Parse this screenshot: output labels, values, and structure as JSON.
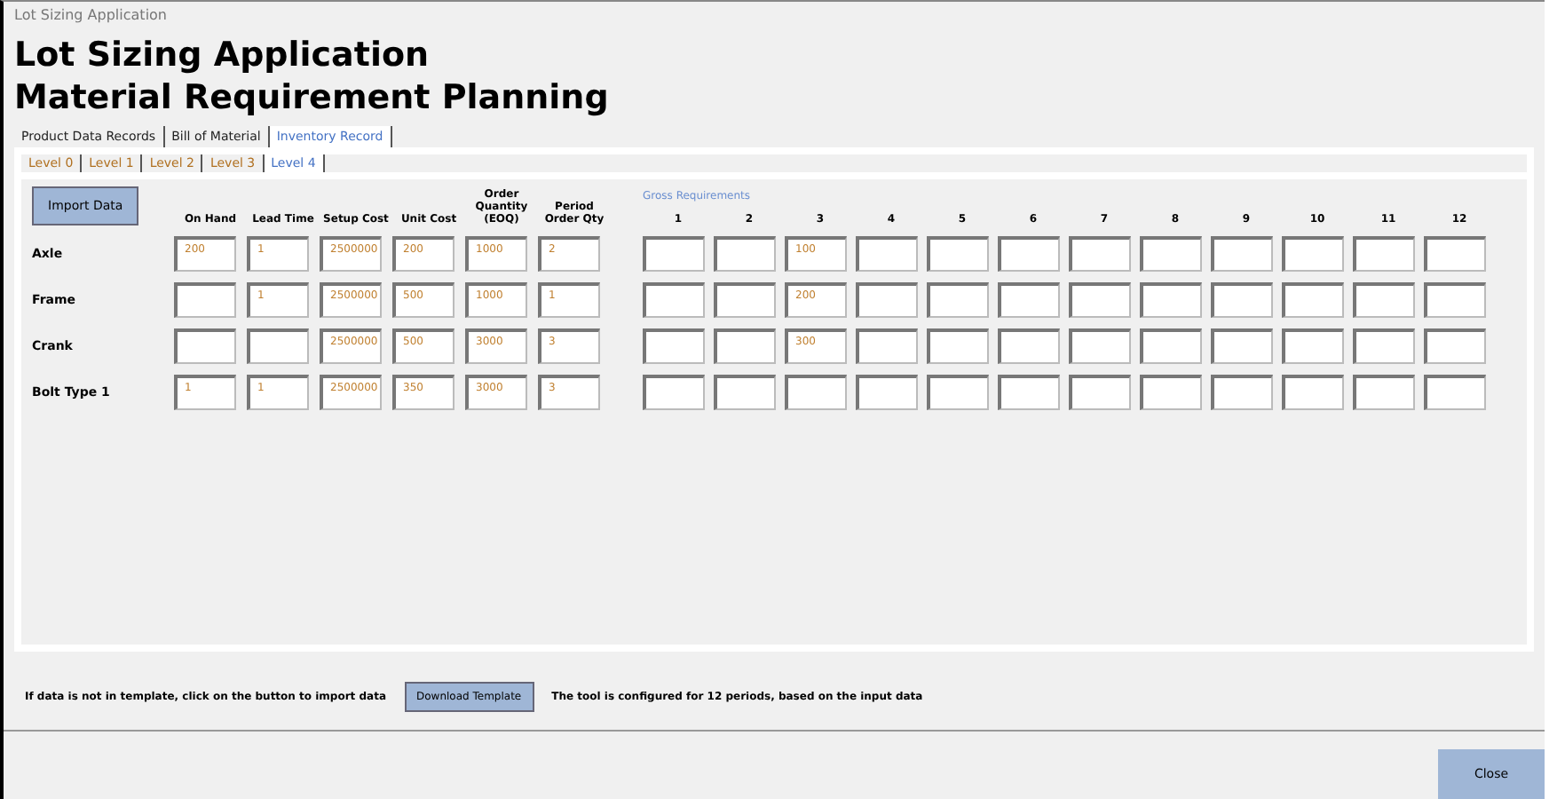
{
  "window": {
    "title": "Lot Sizing Application"
  },
  "headings": [
    "Lot Sizing Application",
    "Material Requirement Planning"
  ],
  "tabs": [
    {
      "label": "Product Data Records",
      "selected": false
    },
    {
      "label": "Bill of Material",
      "selected": false
    },
    {
      "label": "Inventory Record",
      "selected": true
    }
  ],
  "level_tabs": [
    {
      "label": "Level 0",
      "selected": false
    },
    {
      "label": "Level 1",
      "selected": false
    },
    {
      "label": "Level 2",
      "selected": false
    },
    {
      "label": "Level 3",
      "selected": false
    },
    {
      "label": "Level 4",
      "selected": true
    }
  ],
  "import_button": "Import Data",
  "columns": [
    "On Hand",
    "Lead Time",
    "Setup Cost",
    "Unit Cost",
    "Order Quantity (EOQ)",
    "Period Order Qty"
  ],
  "periods_label": "Gross Requirements",
  "periods": [
    "1",
    "2",
    "3",
    "4",
    "5",
    "6",
    "7",
    "8",
    "9",
    "10",
    "11",
    "12"
  ],
  "rows": [
    {
      "name": "Axle",
      "on_hand": "200",
      "lead_time": "1",
      "setup_cost": "2500000",
      "unit_cost": "200",
      "order_quantity": "1000",
      "period_order_qty": "2",
      "gross_requirements": {
        "period_3": "100"
      }
    },
    {
      "name": "Frame",
      "lead_time": "1",
      "setup_cost": "2500000",
      "unit_cost": "500",
      "order_quantity": "1000",
      "period_order_qty": "1",
      "gross_requirements": {
        "period_3": "200"
      }
    },
    {
      "name": "Crank",
      "setup_cost": "2500000",
      "unit_cost": "500",
      "order_quantity": "3000",
      "period_order_qty": "3",
      "gross_requirements": {
        "period_3": "300"
      }
    },
    {
      "name": "Bolt Type 1",
      "on_hand": "1",
      "lead_time": "1",
      "setup_cost": "2500000",
      "unit_cost": "350",
      "order_quantity": "3000",
      "period_order_qty": "3"
    }
  ],
  "footer": {
    "hint": "If data is not in template, click on the button to import data",
    "template_button": "Download Template",
    "note": "The tool is configured for 12 periods, based on the input data"
  },
  "close_button": "Close"
}
